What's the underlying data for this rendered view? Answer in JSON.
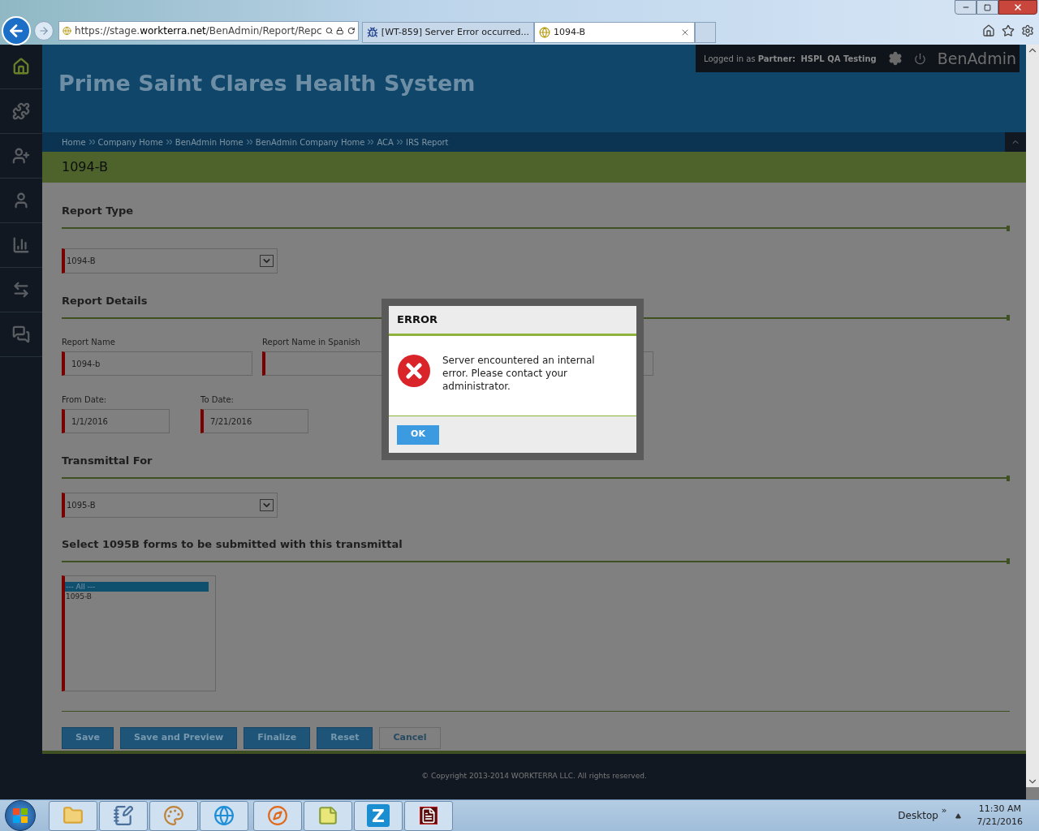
{
  "browser": {
    "address_prefix": "https://stage.",
    "address_domain": "workterra.net",
    "address_path": "/BenAdmin/Report/Repc",
    "tabs": [
      {
        "kind": "bug",
        "title": "[WT-859] Server Error occurred...",
        "selected": false
      },
      {
        "kind": "site",
        "title": "1094-B",
        "selected": true
      }
    ]
  },
  "sidebar": {
    "items": [
      {
        "kind": "home",
        "selected": true
      },
      {
        "kind": "puzzle",
        "selected": false
      },
      {
        "kind": "user-star",
        "selected": false
      },
      {
        "kind": "user",
        "selected": false
      },
      {
        "kind": "chart",
        "selected": false
      },
      {
        "kind": "transfer",
        "selected": false
      },
      {
        "kind": "chat",
        "selected": false
      }
    ]
  },
  "header": {
    "title": "Prime Saint Clares Health System",
    "logged_in": "Logged in as",
    "partner_label": "Partner:",
    "partner_name": "HSPL QA Testing",
    "brand": "BenAdmin"
  },
  "breadcrumbs": [
    "Home",
    "Company Home",
    "BenAdmin Home",
    "BenAdmin Company Home",
    "ACA",
    "IRS Report"
  ],
  "page_title": "1094-B",
  "form": {
    "report_type": {
      "heading": "Report Type",
      "value": "1094-B"
    },
    "details": {
      "heading": "Report Details",
      "report_name_label": "Report Name",
      "report_name": "1094-b",
      "spanish_label": "Report Name in Spanish",
      "from_label": "From Date:",
      "from": "1/1/2016",
      "to_label": "To Date:",
      "to": "7/21/2016"
    },
    "transmittal": {
      "heading": "Transmittal For",
      "value": "1095-B"
    },
    "forms": {
      "heading": "Select 1095B forms to be submitted with this transmittal",
      "options": [
        {
          "label": "--- All ---",
          "selected": true
        },
        {
          "label": "1095-B",
          "selected": false
        }
      ]
    },
    "buttons": [
      {
        "label": "Save",
        "kind": "primary"
      },
      {
        "label": "Save and Preview",
        "kind": "primary"
      },
      {
        "label": "Finalize",
        "kind": "primary"
      },
      {
        "label": "Reset",
        "kind": "primary"
      },
      {
        "label": "Cancel",
        "kind": "secondary"
      }
    ]
  },
  "footer": "© Copyright 2013-2014 WORKTERRA LLC. All rights reserved.",
  "dialog": {
    "title": "ERROR",
    "message": "Server encountered an internal error. Please contact your administrator.",
    "button": "OK"
  },
  "taskbar": {
    "apps": [
      {
        "kind": "folder"
      },
      {
        "kind": "notepad"
      },
      {
        "kind": "paint"
      },
      {
        "kind": "ie"
      },
      {
        "kind": "firefox"
      },
      {
        "kind": "sticky"
      },
      {
        "kind": "letter",
        "label": "Z"
      },
      {
        "kind": "pdf"
      }
    ],
    "desktop": "Desktop",
    "expand": "»",
    "time": "11:30 AM",
    "date": "7/21/2016"
  }
}
